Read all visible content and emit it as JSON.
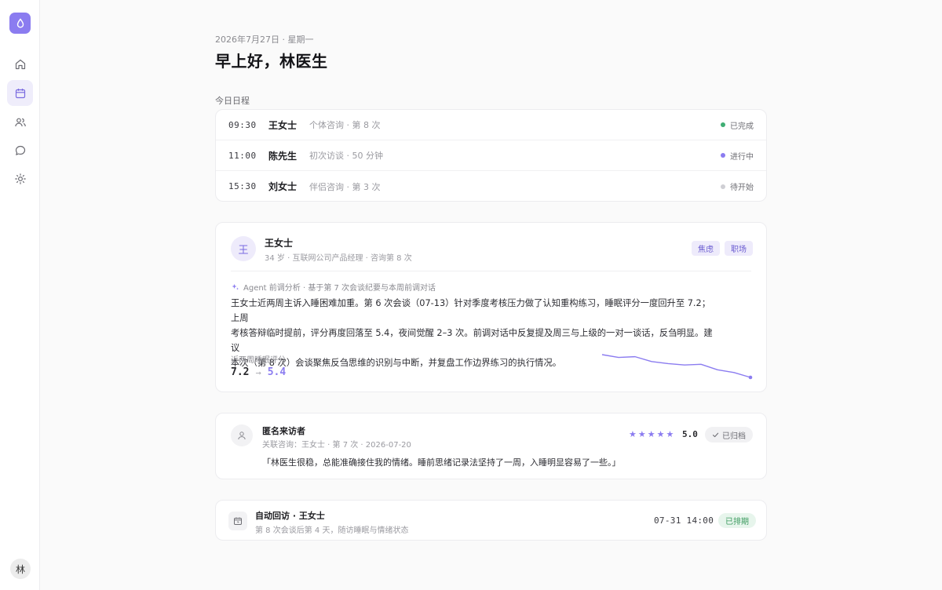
{
  "nav": {
    "logo_icon": "drop-icon",
    "items": [
      {
        "icon": "home-icon",
        "active": false
      },
      {
        "icon": "calendar-icon",
        "active": true
      },
      {
        "icon": "users-icon",
        "active": false
      },
      {
        "icon": "chat-icon",
        "active": false
      },
      {
        "icon": "sun-icon",
        "active": false
      }
    ],
    "user_initial": "林"
  },
  "header": {
    "date": "2026年7月27日 · 星期一",
    "greeting": "早上好，林医生"
  },
  "schedule": {
    "label": "今日日程",
    "rows": [
      {
        "time": "09:30",
        "name": "王女士",
        "desc": "个体咨询 · 第 8 次",
        "status": "已完成",
        "status_color": "#3fae74"
      },
      {
        "time": "11:00",
        "name": "陈先生",
        "desc": "初次访谈 · 50 分钟",
        "status": "进行中",
        "status_color": "#8b7cf0"
      },
      {
        "time": "15:30",
        "name": "刘女士",
        "desc": "伴侣咨询 · 第 3 次",
        "status": "待开始",
        "status_color": "#cfcfd4"
      }
    ]
  },
  "client": {
    "avatar": "王",
    "name": "王女士",
    "meta": "34 岁 · 互联网公司产品经理 · 咨询第 8 次",
    "tags": [
      "焦虑",
      "职场"
    ],
    "agent_line": "Agent 前调分析 · 基于第 7 次会谈纪要与本周前调对话",
    "analysis_lines": [
      "王女士近两周主诉入睡困难加重。第 6 次会谈（07-13）针对季度考核压力做了认知重构练习，睡眠评分一度回升至 7.2；上周",
      "考核答辩临时提前，评分再度回落至 5.4，夜间觉醒 2–3 次。前调对话中反复提及周三与上级的一对一谈话，反刍明显。建议",
      "本次（第 8 次）会谈聚焦反刍思维的识别与中断，并复盘工作边界练习的执行情况。"
    ],
    "trend_label": "近两周睡眠评分",
    "trend_from": "7.2",
    "trend_arrow": "→",
    "trend_to": "5.4",
    "accent": "#8b7cf0"
  },
  "chart_data": {
    "type": "line",
    "title": "",
    "series": [
      {
        "values": [
          7.2,
          7.0,
          7.05,
          6.7,
          6.55,
          6.45,
          6.5,
          6.1,
          5.9,
          5.55
        ]
      }
    ]
  },
  "review": {
    "name": "匿名来访者",
    "meta": "关联咨询：王女士 · 第 7 次 · 2026-07-20",
    "stars": 5,
    "rating": "5.0",
    "status": "已归档",
    "quote": "「林医生很稳，总能准确接住我的情绪。睡前思绪记录法坚持了一周，入睡明显容易了一些。」"
  },
  "followup": {
    "title": "自动回访 · 王女士",
    "subtitle": "第 8 次会谈后第 4 天，随访睡眠与情绪状态",
    "time": "07-31 14:00",
    "status": "已排期"
  }
}
